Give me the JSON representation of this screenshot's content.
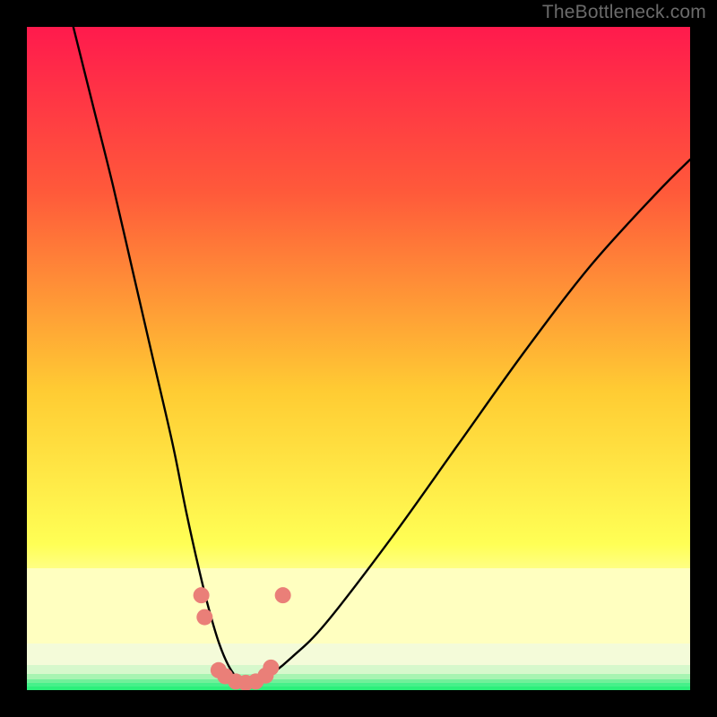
{
  "watermark": "TheBottleneck.com",
  "chart_data": {
    "type": "line",
    "title": "",
    "xlabel": "",
    "ylabel": "",
    "xlim": [
      0,
      100
    ],
    "ylim": [
      0,
      100
    ],
    "background_gradient_stops": [
      {
        "pct": 0,
        "color": "#ff1a4d"
      },
      {
        "pct": 25,
        "color": "#ff5a3a"
      },
      {
        "pct": 55,
        "color": "#ffcc33"
      },
      {
        "pct": 78,
        "color": "#ffff55"
      },
      {
        "pct": 86,
        "color": "#ffffbb"
      },
      {
        "pct": 100,
        "color": "#26e86f"
      }
    ],
    "green_bands_from_bottom": [
      {
        "h": 4,
        "color": "#2cf07b"
      },
      {
        "h": 4,
        "color": "#46f08a"
      },
      {
        "h": 4,
        "color": "#70f09a"
      },
      {
        "h": 6,
        "color": "#a7f4b2"
      },
      {
        "h": 10,
        "color": "#d6f8cc"
      },
      {
        "h": 24,
        "color": "#f4fbd9"
      },
      {
        "h": 84,
        "color": "#ffffc0"
      }
    ],
    "series": [
      {
        "name": "curve",
        "x": [
          7,
          10,
          13,
          16,
          19,
          22,
          24,
          26,
          27.5,
          29,
          30.5,
          32,
          33,
          34,
          35,
          37,
          40,
          45,
          55,
          65,
          75,
          85,
          95,
          100
        ],
        "y": [
          100,
          88,
          76,
          63,
          50,
          37,
          27,
          18,
          12,
          7,
          3.5,
          1.5,
          1,
          1,
          1.3,
          2.5,
          5,
          10,
          23,
          37,
          51,
          64,
          75,
          80
        ]
      }
    ],
    "markers": {
      "name": "highlight-points",
      "color": "#ea7f78",
      "radius": 9,
      "points": [
        {
          "x": 26.3,
          "y": 14.3
        },
        {
          "x": 26.8,
          "y": 11.0
        },
        {
          "x": 28.9,
          "y": 3.0
        },
        {
          "x": 29.9,
          "y": 2.1
        },
        {
          "x": 31.5,
          "y": 1.3
        },
        {
          "x": 33.0,
          "y": 1.1
        },
        {
          "x": 34.5,
          "y": 1.3
        },
        {
          "x": 36.0,
          "y": 2.2
        },
        {
          "x": 36.8,
          "y": 3.4
        },
        {
          "x": 38.6,
          "y": 14.3
        }
      ]
    }
  }
}
